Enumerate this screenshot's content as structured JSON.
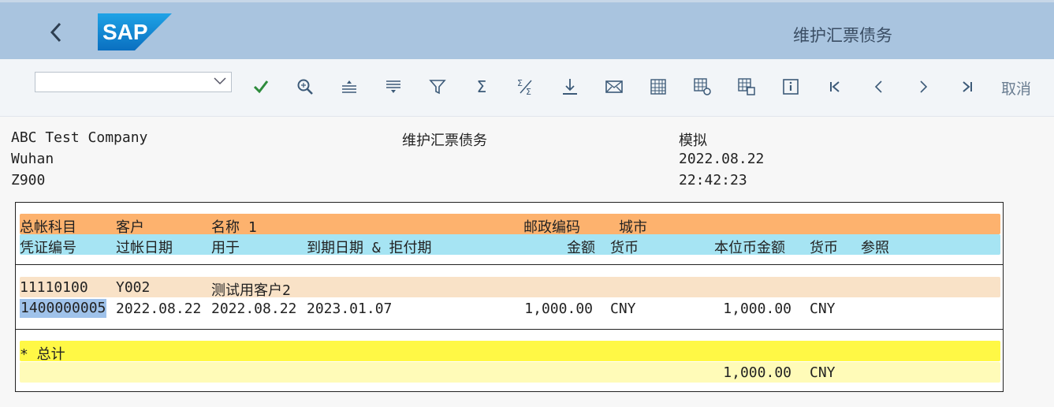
{
  "header": {
    "title": "维护汇票债务"
  },
  "toolbar": {
    "cancel_label": "取消",
    "combo_value": ""
  },
  "report_header": {
    "company": "ABC Test Company",
    "city": "Wuhan",
    "code": "Z900",
    "title": "维护汇票债务",
    "mode": "模拟",
    "date": "2022.08.22",
    "time": "22:42:23"
  },
  "columns": {
    "row1": {
      "gl_account": "总帐科目",
      "customer": "客户",
      "name": "名称 1",
      "postal": "邮政编码",
      "city": "城市"
    },
    "row2": {
      "doc_no": "凭证编号",
      "posting_date": "过帐日期",
      "for": "用于",
      "due_date": "到期日期 & 拒付期",
      "amount": "金额",
      "currency": "货币",
      "local_amount": "本位币金额",
      "local_currency": "货币",
      "reference": "参照"
    }
  },
  "group": {
    "gl_account": "11110100",
    "customer": "Y002",
    "name": "测试用客户2"
  },
  "item": {
    "doc_no": "1400000005",
    "posting_date": "2022.08.22",
    "for": "2022.08.22",
    "due_date": "2023.01.07",
    "amount": "1,000.00",
    "currency": "CNY",
    "local_amount": "1,000.00",
    "local_currency": "CNY"
  },
  "total": {
    "label": "* 总计",
    "amount": "1,000.00",
    "currency": "CNY"
  },
  "colors": {
    "shell": "#a9c4df",
    "orange_band": "#fdb26e",
    "cyan_band": "#a6e4f3",
    "group_band": "#f9e2c7",
    "yellow_band": "#fff845",
    "light_yellow_band": "#fffbb8",
    "accept_green": "#2e8b3c",
    "logo_blue": "#1a8fd6"
  }
}
